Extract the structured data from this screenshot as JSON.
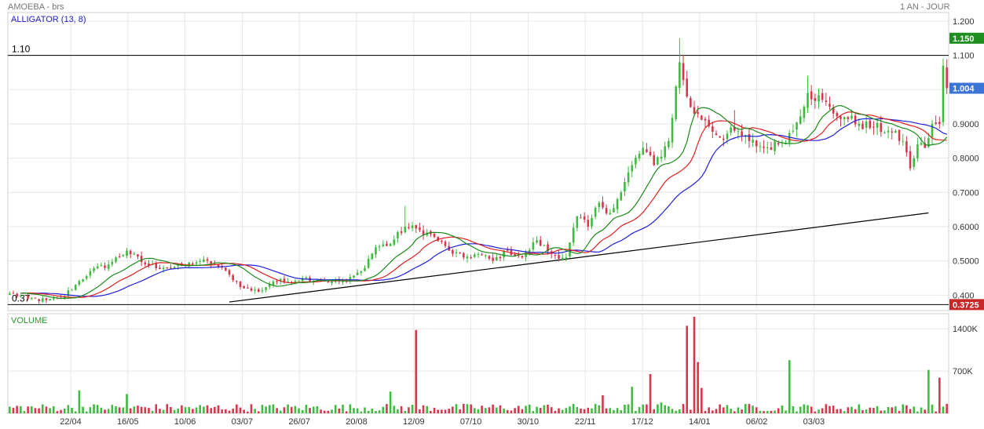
{
  "header": {
    "instrument": "AMOEBA - brs",
    "period": "1 AN - JOUR"
  },
  "colors": {
    "up": "#3cbc3c",
    "down": "#d9344a",
    "jaw": "#1f1fdc",
    "teeth": "#e02020",
    "lips": "#1a8a1a",
    "grid": "#e6e6e6",
    "line": "#000000",
    "last_badge": "#3b73d6",
    "high_badge": "#1e8e1e",
    "low_badge": "#c62828"
  },
  "chart_data": [
    {
      "type": "candlestick",
      "indicator_label": "ALLIGATOR (13, 8)",
      "ylim": [
        0.355,
        1.225
      ],
      "y_ticks": [
        0.4,
        0.5,
        0.6,
        0.7,
        0.8,
        0.9,
        1.0,
        1.1,
        1.2
      ],
      "y_tick_labels": [
        "0.400",
        "0.5000",
        "0.6000",
        "0.7000",
        "0.8000",
        "0.9000",
        "1.000",
        "1.100",
        "1.200"
      ],
      "x_tick_labels": [
        "22/04",
        "16/05",
        "10/06",
        "03/07",
        "26/07",
        "20/08",
        "12/09",
        "07/10",
        "30/10",
        "22/11",
        "17/12",
        "14/01",
        "06/02",
        "03/03"
      ],
      "horizontal_lines": [
        {
          "label": "1.10",
          "value": 1.1
        },
        {
          "label": "0.37",
          "value": 0.3725
        }
      ],
      "price_badges": [
        {
          "label": "1.150",
          "value": 1.15,
          "kind": "high"
        },
        {
          "label": "1.004",
          "value": 1.004,
          "kind": "last"
        },
        {
          "label": "0.3725",
          "value": 0.3725,
          "kind": "low"
        }
      ],
      "trendline": {
        "start": {
          "index": 60,
          "value": 0.38
        },
        "end": {
          "index": 251,
          "value": 0.64
        }
      },
      "series_names": [
        "Jaw",
        "Teeth",
        "Lips"
      ],
      "close_anchors": [
        [
          0,
          0.405
        ],
        [
          5,
          0.39
        ],
        [
          10,
          0.385
        ],
        [
          14,
          0.39
        ],
        [
          18,
          0.43
        ],
        [
          22,
          0.47
        ],
        [
          27,
          0.49
        ],
        [
          32,
          0.53
        ],
        [
          37,
          0.49
        ],
        [
          42,
          0.48
        ],
        [
          47,
          0.485
        ],
        [
          52,
          0.5
        ],
        [
          56,
          0.49
        ],
        [
          60,
          0.46
        ],
        [
          64,
          0.42
        ],
        [
          68,
          0.41
        ],
        [
          72,
          0.44
        ],
        [
          76,
          0.44
        ],
        [
          80,
          0.45
        ],
        [
          84,
          0.445
        ],
        [
          88,
          0.44
        ],
        [
          92,
          0.44
        ],
        [
          96,
          0.47
        ],
        [
          100,
          0.54
        ],
        [
          104,
          0.55
        ],
        [
          108,
          0.6
        ],
        [
          112,
          0.59
        ],
        [
          116,
          0.57
        ],
        [
          120,
          0.53
        ],
        [
          124,
          0.51
        ],
        [
          128,
          0.52
        ],
        [
          132,
          0.5
        ],
        [
          136,
          0.53
        ],
        [
          140,
          0.51
        ],
        [
          144,
          0.56
        ],
        [
          148,
          0.52
        ],
        [
          152,
          0.51
        ],
        [
          155,
          0.63
        ],
        [
          158,
          0.6
        ],
        [
          161,
          0.67
        ],
        [
          164,
          0.64
        ],
        [
          167,
          0.7
        ],
        [
          170,
          0.78
        ],
        [
          173,
          0.83
        ],
        [
          176,
          0.78
        ],
        [
          180,
          0.85
        ],
        [
          183,
          1.08
        ],
        [
          185,
          0.98
        ],
        [
          187,
          0.93
        ],
        [
          190,
          0.91
        ],
        [
          194,
          0.86
        ],
        [
          198,
          0.88
        ],
        [
          202,
          0.85
        ],
        [
          206,
          0.83
        ],
        [
          210,
          0.84
        ],
        [
          214,
          0.88
        ],
        [
          218,
          0.99
        ],
        [
          222,
          0.97
        ],
        [
          225,
          0.93
        ],
        [
          228,
          0.92
        ],
        [
          232,
          0.9
        ],
        [
          236,
          0.89
        ],
        [
          240,
          0.88
        ],
        [
          244,
          0.85
        ],
        [
          246,
          0.77
        ],
        [
          248,
          0.84
        ],
        [
          250,
          0.83
        ],
        [
          252,
          0.9
        ],
        [
          254,
          0.9
        ],
        [
          255,
          1.07
        ],
        [
          256,
          1.004
        ]
      ],
      "volume": {
        "label": "VOLUME",
        "ylim": [
          0,
          1650000
        ],
        "y_ticks": [
          700000,
          1400000
        ],
        "y_tick_labels": [
          "700K",
          "1400K"
        ],
        "spikes": [
          [
            19,
            380000
          ],
          [
            32,
            320000
          ],
          [
            104,
            360000
          ],
          [
            111,
            1380000
          ],
          [
            162,
            300000
          ],
          [
            170,
            440000
          ],
          [
            175,
            650000
          ],
          [
            178,
            180000
          ],
          [
            185,
            1450000
          ],
          [
            187,
            1600000
          ],
          [
            188,
            850000
          ],
          [
            189,
            420000
          ],
          [
            213,
            880000
          ],
          [
            251,
            720000
          ],
          [
            254,
            590000
          ]
        ]
      }
    }
  ]
}
